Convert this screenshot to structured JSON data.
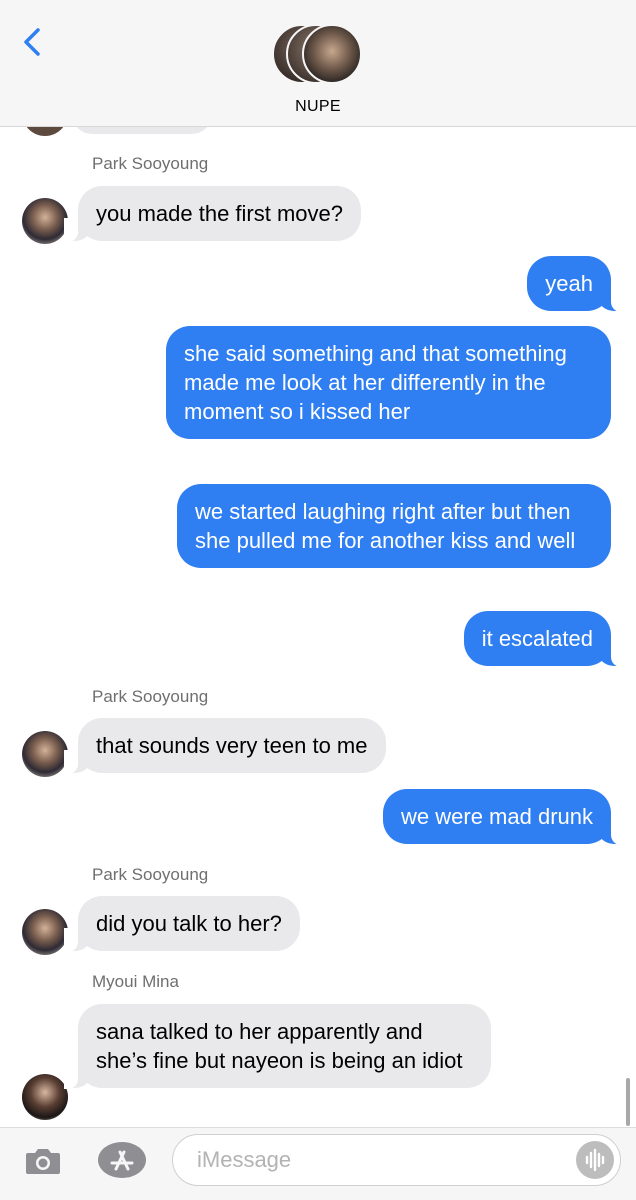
{
  "header": {
    "group_name": "NUPE",
    "back_icon": "chevron-left-icon"
  },
  "messages": [
    {
      "sender": "Park Sooyoung",
      "text": "you made the first move?",
      "direction": "in"
    },
    {
      "text": "yeah",
      "direction": "out"
    },
    {
      "text": "she said something and that something made me look at her differently in the moment so i kissed her",
      "direction": "out"
    },
    {
      "text": "we started laughing right after but then she pulled me for another kiss and well",
      "direction": "out"
    },
    {
      "text": "it escalated",
      "direction": "out"
    },
    {
      "sender": "Park Sooyoung",
      "text": "that sounds very teen to me",
      "direction": "in"
    },
    {
      "text": "we were mad drunk",
      "direction": "out"
    },
    {
      "sender": "Park Sooyoung",
      "text": "did you talk to her?",
      "direction": "in"
    },
    {
      "sender": "Myoui Mina",
      "text": "sana talked to her apparently and she’s fine but nayeon is being an idiot",
      "direction": "in"
    }
  ],
  "input": {
    "placeholder": "iMessage",
    "camera_icon": "camera-icon",
    "apps_icon": "app-store-icon",
    "audio_icon": "audio-waveform-icon"
  },
  "colors": {
    "outgoing_bubble": "#2f7ff2",
    "incoming_bubble": "#e9e9eb",
    "accent": "#2f7ff2"
  }
}
